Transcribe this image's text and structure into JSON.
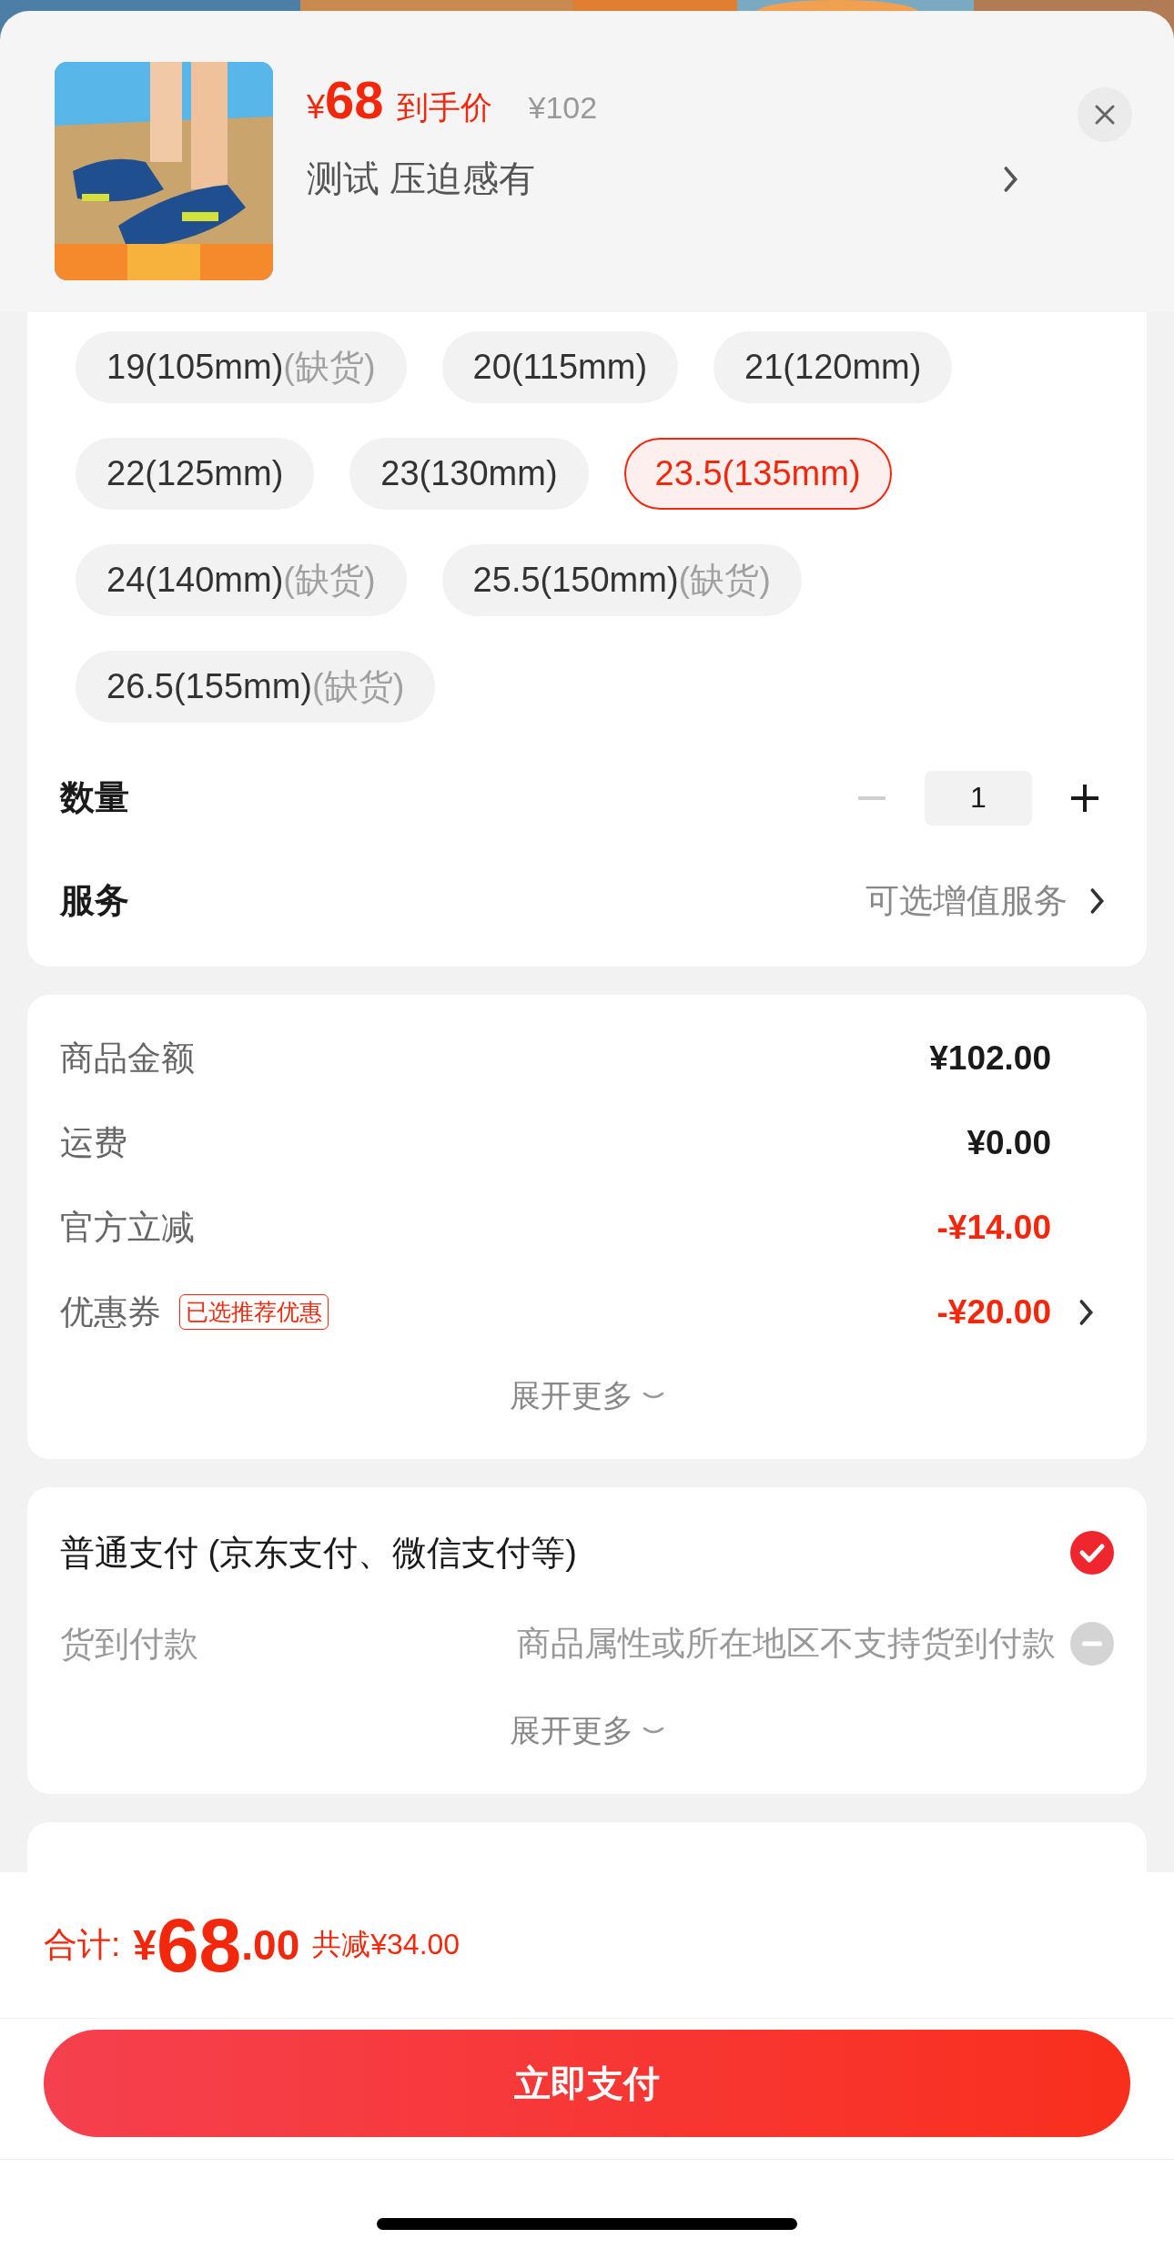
{
  "product": {
    "price_symbol": "¥",
    "price": "68",
    "price_label": "到手价",
    "original_price": "¥102",
    "selected_spec": "测试 压迫感有"
  },
  "sizes": [
    {
      "label": "19(105mm)",
      "note": "(缺货)",
      "selected": false
    },
    {
      "label": "20(115mm)",
      "selected": false
    },
    {
      "label": "21(120mm)",
      "selected": false
    },
    {
      "label": "22(125mm)",
      "selected": false
    },
    {
      "label": "23(130mm)",
      "selected": false
    },
    {
      "label": "23.5(135mm)",
      "selected": true
    },
    {
      "label": "24(140mm)",
      "note": "(缺货)",
      "selected": false
    },
    {
      "label": "25.5(150mm)",
      "note": "(缺货)",
      "selected": false
    },
    {
      "label": "26.5(155mm)",
      "note": "(缺货)",
      "selected": false
    }
  ],
  "quantity": {
    "label": "数量",
    "value": "1",
    "minus_disabled": true
  },
  "service": {
    "label": "服务",
    "value": "可选增值服务"
  },
  "price_details": {
    "rows": [
      {
        "label": "商品金额",
        "value": "¥102.00",
        "discount": false,
        "chevron": false
      },
      {
        "label": "运费",
        "value": "¥0.00",
        "discount": false,
        "chevron": false
      },
      {
        "label": "官方立减",
        "value": "-¥14.00",
        "discount": true,
        "chevron": false
      },
      {
        "label": "优惠券",
        "badge": "已选推荐优惠",
        "value": "-¥20.00",
        "discount": true,
        "chevron": true
      }
    ],
    "expand": "展开更多"
  },
  "payment": {
    "options": [
      {
        "label": "普通支付 (京东支付、微信支付等)",
        "selected": true,
        "disabled": false
      },
      {
        "label": "货到付款",
        "note": "商品属性或所在地区不支持货到付款",
        "selected": false,
        "disabled": true
      }
    ],
    "expand": "展开更多"
  },
  "total": {
    "label": "合计:",
    "currency": "¥",
    "integer": "68",
    "decimal": ".00",
    "saving": "共减¥34.00"
  },
  "pay_button": "立即支付"
}
